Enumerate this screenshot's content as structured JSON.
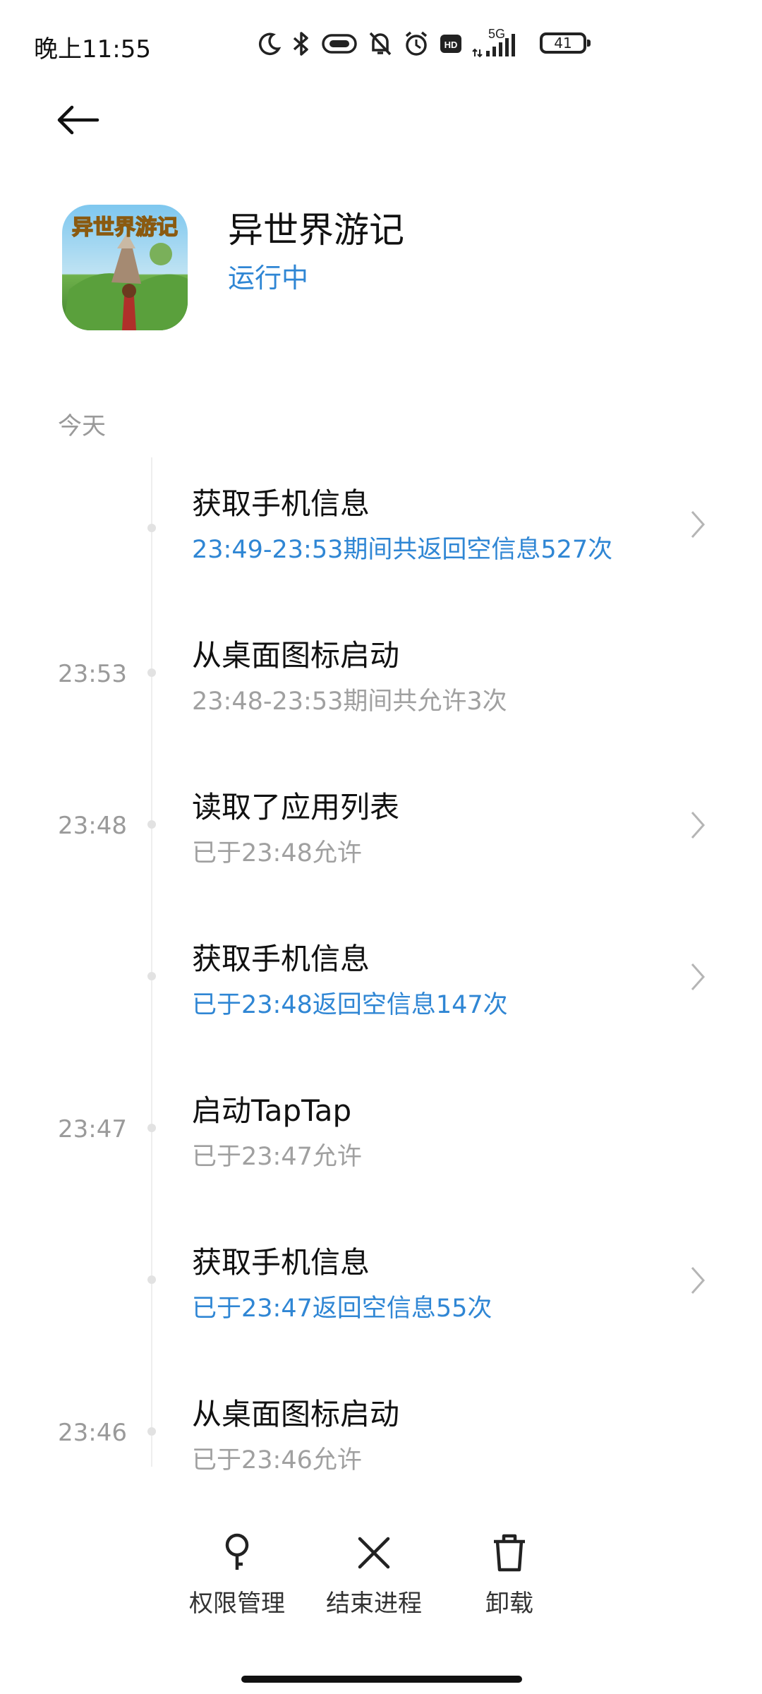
{
  "status_bar": {
    "time": "晚上11:55",
    "network": "5G",
    "battery": "41"
  },
  "app": {
    "name": "异世界游记",
    "status": "运行中",
    "icon_text": "异世界游记",
    "status_color": "#2f86d4"
  },
  "timeline": {
    "section_label": "今天",
    "events": [
      {
        "time": "",
        "title": "获取手机信息",
        "detail": "23:49-23:53期间共返回空信息527次",
        "highlight": true,
        "has_chevron": true
      },
      {
        "time": "23:53",
        "title": "从桌面图标启动",
        "detail": "23:48-23:53期间共允许3次",
        "highlight": false,
        "has_chevron": false
      },
      {
        "time": "23:48",
        "title": "读取了应用列表",
        "detail": "已于23:48允许",
        "highlight": false,
        "has_chevron": true
      },
      {
        "time": "",
        "title": "获取手机信息",
        "detail": "已于23:48返回空信息147次",
        "highlight": true,
        "has_chevron": true
      },
      {
        "time": "23:47",
        "title": "启动TapTap",
        "detail": "已于23:47允许",
        "highlight": false,
        "has_chevron": false
      },
      {
        "time": "",
        "title": "获取手机信息",
        "detail": "已于23:47返回空信息55次",
        "highlight": true,
        "has_chevron": true
      },
      {
        "time": "23:46",
        "title": "从桌面图标启动",
        "detail": "已于23:46允许",
        "highlight": false,
        "has_chevron": false
      }
    ]
  },
  "bottom_bar": {
    "permissions_label": "权限管理",
    "kill_label": "结束进程",
    "uninstall_label": "卸载"
  },
  "icons": {
    "back": "back-arrow-icon",
    "chevron": "chevron-right-icon",
    "permissions": "key-icon",
    "kill": "close-icon",
    "uninstall": "trash-icon"
  }
}
